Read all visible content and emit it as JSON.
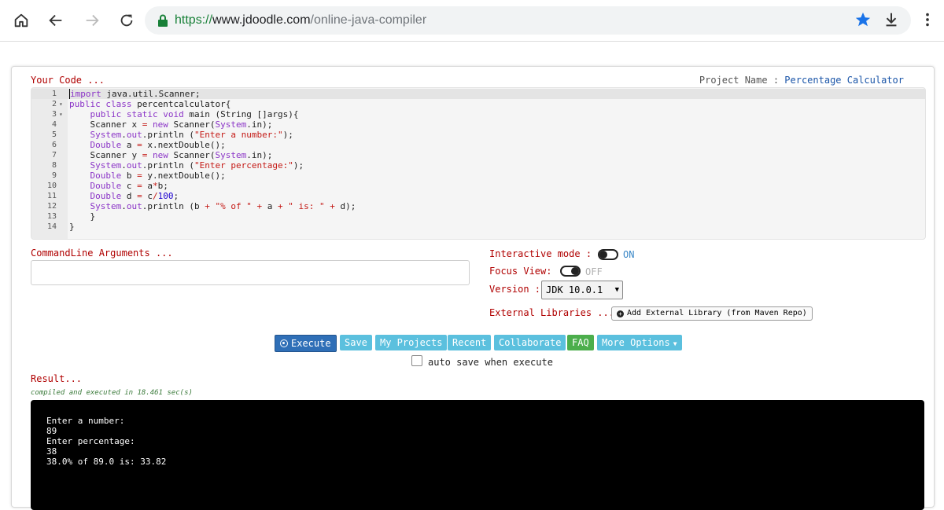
{
  "browser": {
    "url_scheme": "https://",
    "url_host": "www.jdoodle.com",
    "url_path": "/online-java-compiler"
  },
  "editor": {
    "label": "Your Code ...",
    "project_label": "Project Name : ",
    "project_name": "Percentage Calculator",
    "lines": [
      {
        "n": "1",
        "fold": "",
        "code": "import java.util.Scanner;"
      },
      {
        "n": "2",
        "fold": "▾",
        "code": "public class percentcalculator{"
      },
      {
        "n": "3",
        "fold": "▾",
        "code": "    public static void main (String []args){"
      },
      {
        "n": "4",
        "fold": "",
        "code": "    Scanner x = new Scanner(System.in);"
      },
      {
        "n": "5",
        "fold": "",
        "code": "    System.out.println (\"Enter a number:\");"
      },
      {
        "n": "6",
        "fold": "",
        "code": "    Double a = x.nextDouble();"
      },
      {
        "n": "7",
        "fold": "",
        "code": "    Scanner y = new Scanner(System.in);"
      },
      {
        "n": "8",
        "fold": "",
        "code": "    System.out.println (\"Enter percentage:\");"
      },
      {
        "n": "9",
        "fold": "",
        "code": "    Double b = y.nextDouble();"
      },
      {
        "n": "10",
        "fold": "",
        "code": "    Double c = a*b;"
      },
      {
        "n": "11",
        "fold": "",
        "code": "    Double d = c/100;"
      },
      {
        "n": "12",
        "fold": "",
        "code": "    System.out.println (b + \"% of \" + a + \" is: \" + d);"
      },
      {
        "n": "13",
        "fold": "",
        "code": "    }"
      },
      {
        "n": "14",
        "fold": "",
        "code": "}"
      }
    ]
  },
  "cmdline": {
    "label": "CommandLine Arguments ...",
    "value": ""
  },
  "options": {
    "interactive_label": "Interactive mode :",
    "interactive_state": "ON",
    "focus_label": "Focus View:",
    "focus_state": "OFF",
    "version_label": "Version :",
    "version_value": "JDK 10.0.1",
    "ext_label": "External Libraries ...",
    "ext_button": "Add External Library (from Maven Repo)"
  },
  "actions": {
    "execute": "Execute",
    "save": "Save",
    "my_projects": "My Projects",
    "recent": "Recent",
    "collaborate": "Collaborate",
    "faq": "FAQ",
    "more_options": "More Options",
    "autosave": "auto save when execute"
  },
  "result": {
    "label": "Result...",
    "compiled": "compiled and executed in 18.461 sec(s)",
    "output": [
      "Enter a number:",
      "89",
      "Enter percentage:",
      "38",
      "38.0% of 89.0 is: 33.82"
    ]
  },
  "colors": {
    "label_red": "#b00000",
    "execute_blue": "#2f6fb7",
    "info_blue": "#5bc0de",
    "faq_green": "#4cae4c"
  }
}
